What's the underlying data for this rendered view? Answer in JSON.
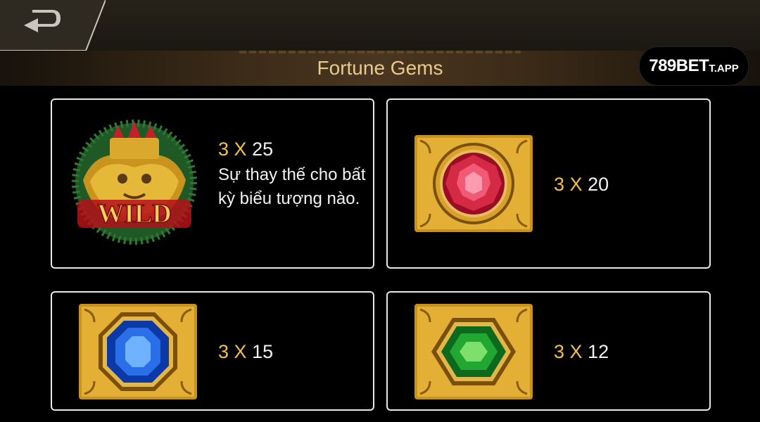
{
  "header": {
    "title": "Fortune Gems",
    "back_icon": "back-arrow-icon"
  },
  "brand": {
    "name_main": "789BET",
    "name_suffix": "T.APP"
  },
  "paytable": [
    {
      "symbol": "wild",
      "symbol_label": "WILD",
      "count": "3",
      "x": "X",
      "payout": "25",
      "description": "Sự thay thế cho bất kỳ biểu tượng nào."
    },
    {
      "symbol": "red-gem",
      "count": "3",
      "x": "X",
      "payout": "20"
    },
    {
      "symbol": "blue-gem",
      "count": "3",
      "x": "X",
      "payout": "15"
    },
    {
      "symbol": "green-gem",
      "count": "3",
      "x": "X",
      "payout": "12"
    }
  ],
  "colors": {
    "accent": "#f0c24b",
    "title": "#e8c98e",
    "card_border": "#e8e8e8"
  }
}
